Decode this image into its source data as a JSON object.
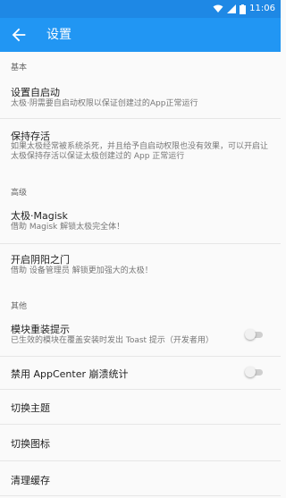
{
  "status_bar": {
    "time": "11:06"
  },
  "app_bar": {
    "title": "设置"
  },
  "sections": {
    "basic": "基本",
    "advanced": "高级",
    "other": "其他"
  },
  "items": {
    "autostart": {
      "title": "设置自启动",
      "subtitle": "太极·阴需要自启动权限以保证创建过的App正常运行"
    },
    "keepalive": {
      "title": "保持存活",
      "subtitle": "如果太极经常被系统杀死，并且给予自启动权限也没有效果，可以开启让太极保持存活以保证太极创建过的 App 正常运行"
    },
    "magisk": {
      "title": "太极·Magisk",
      "subtitle": "借助 Magisk 解锁太极完全体！"
    },
    "yinyang": {
      "title": "开启阴阳之门",
      "subtitle": "借助 设备管理员 解锁更加强大的太极！"
    },
    "reinstall_hint": {
      "title": "模块重装提示",
      "subtitle": "已生效的模块在覆盖安装时发出 Toast 提示（开发者用）",
      "enabled": false
    },
    "appcenter": {
      "title": "禁用 AppCenter 崩溃统计",
      "enabled": false
    },
    "theme": {
      "title": "切换主题"
    },
    "icon": {
      "title": "切换图标"
    },
    "cache": {
      "title": "清理缓存"
    }
  },
  "colors": {
    "primary": "#2196f3",
    "status_bar": "#1e88e5"
  }
}
